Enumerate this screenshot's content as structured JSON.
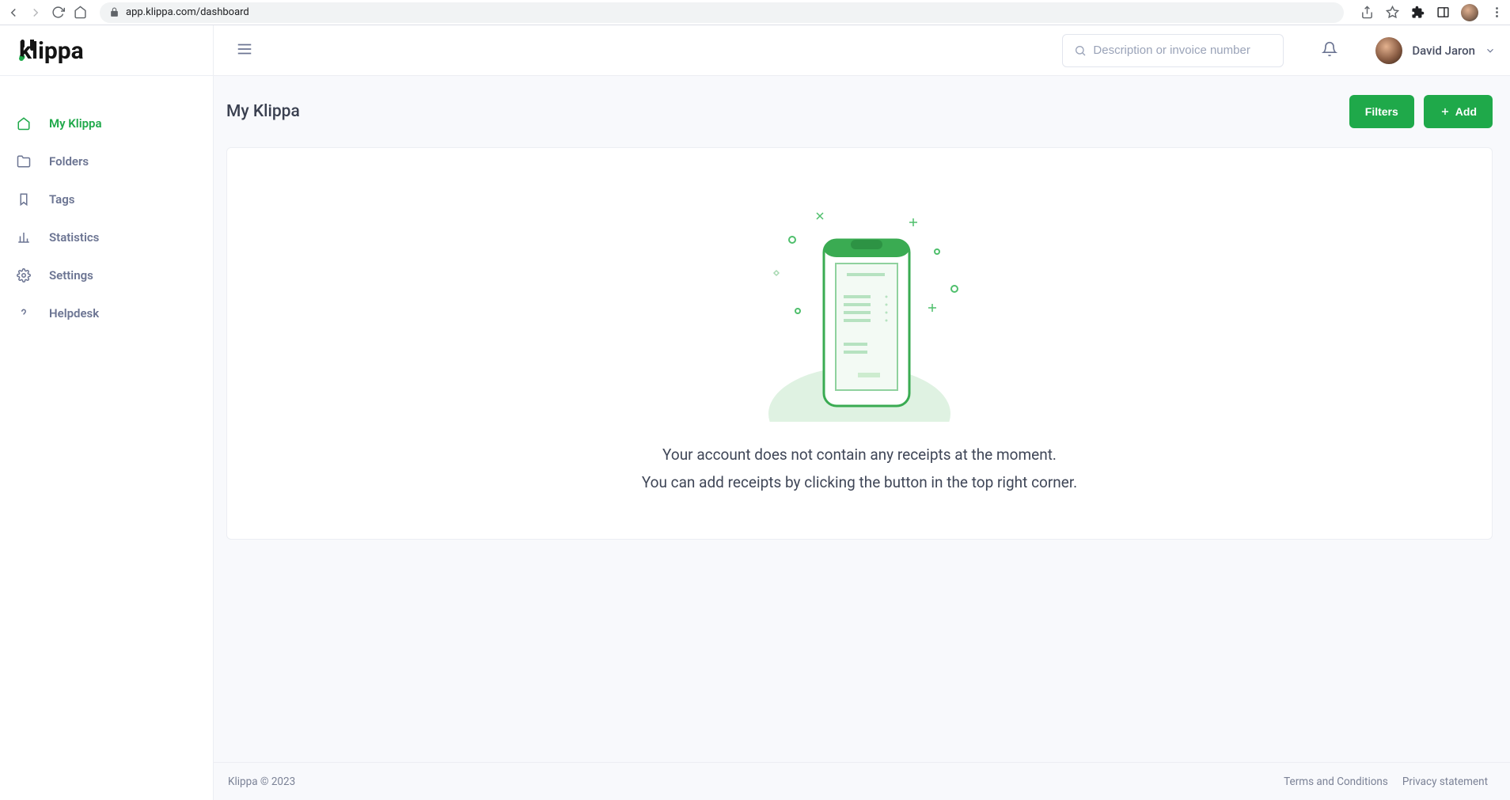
{
  "browser": {
    "url": "app.klippa.com/dashboard"
  },
  "brand": {
    "name": "klippa"
  },
  "sidebar": {
    "items": [
      {
        "label": "My Klippa",
        "icon": "home-icon",
        "active": true
      },
      {
        "label": "Folders",
        "icon": "folder-icon",
        "active": false
      },
      {
        "label": "Tags",
        "icon": "tag-icon",
        "active": false
      },
      {
        "label": "Statistics",
        "icon": "bar-chart-icon",
        "active": false
      },
      {
        "label": "Settings",
        "icon": "gear-icon",
        "active": false
      },
      {
        "label": "Helpdesk",
        "icon": "help-icon",
        "active": false
      }
    ]
  },
  "header": {
    "search_placeholder": "Description or invoice number",
    "user_name": "David Jaron"
  },
  "page": {
    "title": "My Klippa",
    "filters_label": "Filters",
    "add_label": "Add"
  },
  "empty_state": {
    "line1": "Your account does not contain any receipts at the moment.",
    "line2": "You can add receipts by clicking the button in the top right corner."
  },
  "footer": {
    "copyright": "Klippa © 2023",
    "terms": "Terms and Conditions",
    "privacy": "Privacy statement"
  }
}
